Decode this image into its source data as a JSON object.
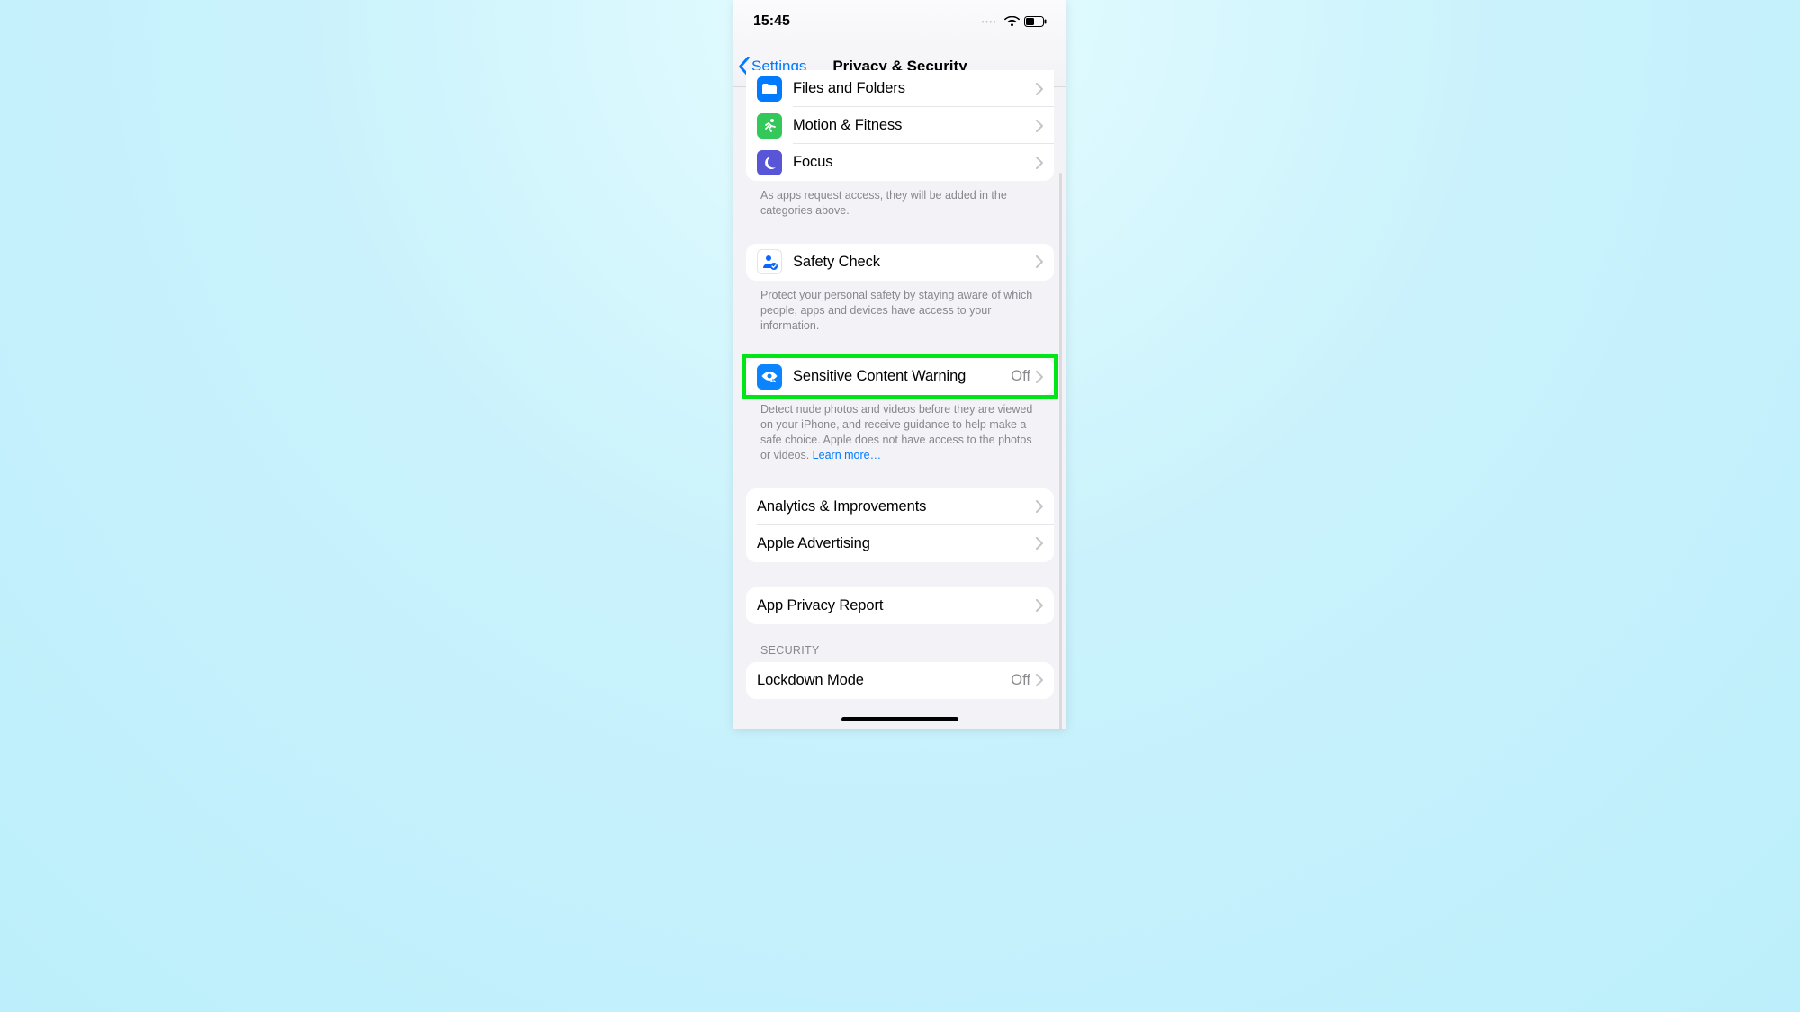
{
  "status": {
    "time": "15:45"
  },
  "nav": {
    "back_label": "Settings",
    "title": "Privacy & Security"
  },
  "group_top": {
    "items": [
      {
        "label": "Files and Folders"
      },
      {
        "label": "Motion & Fitness"
      },
      {
        "label": "Focus"
      }
    ],
    "footer": "As apps request access, they will be added in the categories above."
  },
  "safety_check": {
    "label": "Safety Check",
    "footer": "Protect your personal safety by staying aware of which people, apps and devices have access to your information."
  },
  "scw": {
    "label": "Sensitive Content Warning",
    "value": "Off",
    "footer": "Detect nude photos and videos before they are viewed on your iPhone, and receive guidance to help make a safe choice. Apple does not have access to the photos or videos. ",
    "learn_more": "Learn more…"
  },
  "analytics": {
    "items": [
      {
        "label": "Analytics & Improvements"
      },
      {
        "label": "Apple Advertising"
      }
    ]
  },
  "app_privacy": {
    "label": "App Privacy Report"
  },
  "security_header": "SECURITY",
  "lockdown": {
    "label": "Lockdown Mode",
    "value": "Off"
  }
}
